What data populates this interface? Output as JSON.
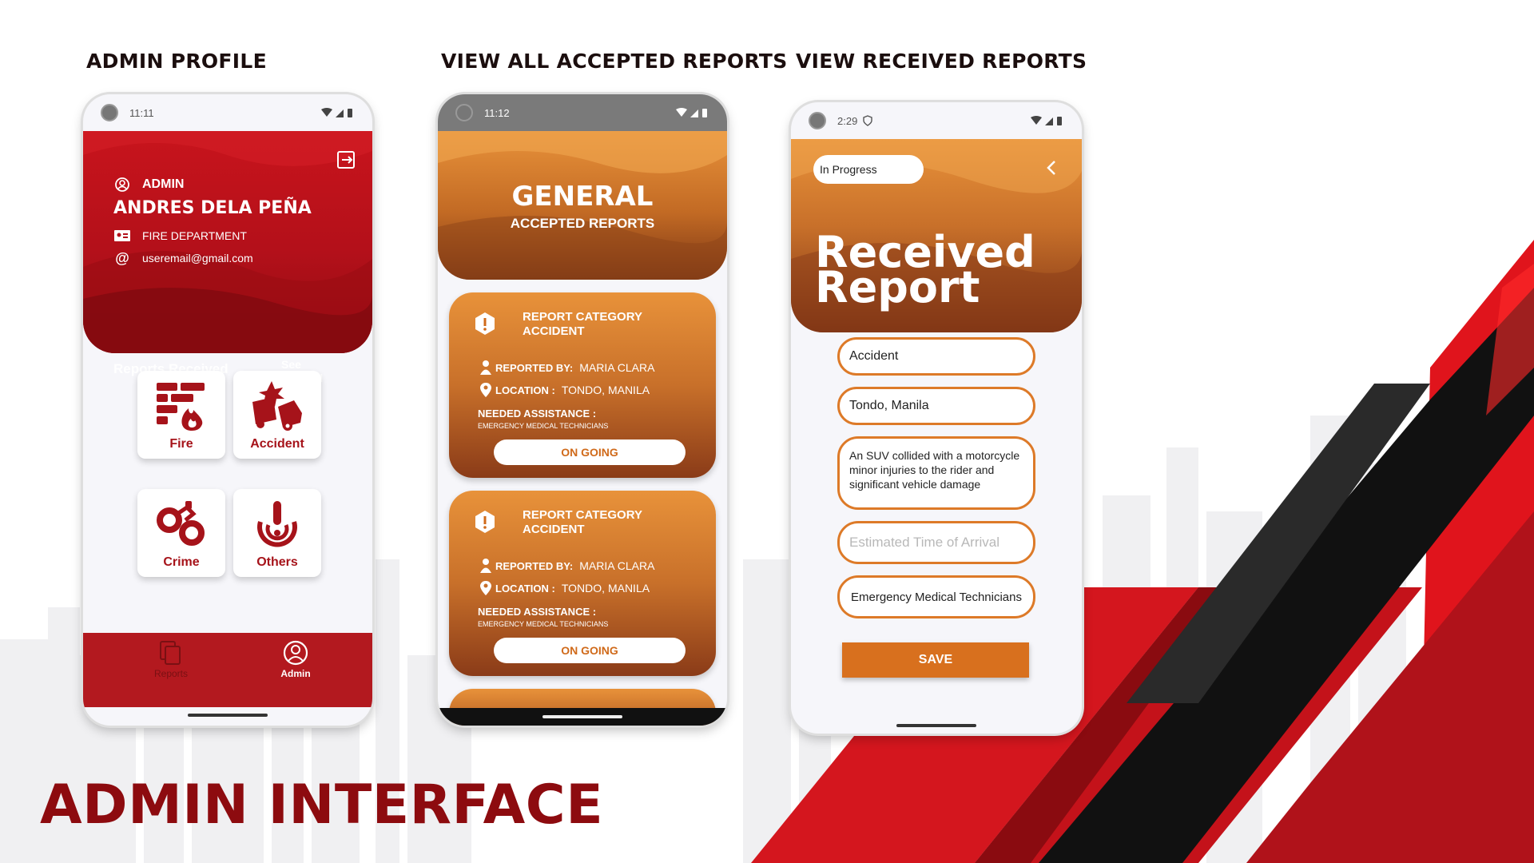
{
  "colors": {
    "brand_red": "#b3191f",
    "dark_red": "#8d0b0f",
    "orange": "#d8701e",
    "orange_light": "#e8923a"
  },
  "titles": {
    "admin_profile": "ADMIN PROFILE",
    "accepted_reports": "VIEW ALL ACCEPTED REPORTS",
    "received_reports": "VIEW RECEIVED REPORTS",
    "main": "ADMIN INTERFACE"
  },
  "phone1": {
    "time": "11:11",
    "role": "ADMIN",
    "name": "ANDRES DELA PEÑA",
    "department": "FIRE DEPARTMENT",
    "email": "useremail@gmail.com",
    "reports_received": "Reports Received",
    "see_general": "See General",
    "categories": [
      {
        "label": "Fire",
        "icon": "fire-wall-icon"
      },
      {
        "label": "Accident",
        "icon": "car-crash-icon"
      },
      {
        "label": "Crime",
        "icon": "handcuffs-icon"
      },
      {
        "label": "Others",
        "icon": "alert-signal-icon"
      }
    ],
    "nav": [
      {
        "label": "Reports",
        "icon": "reports-icon",
        "active": false
      },
      {
        "label": "Admin",
        "icon": "admin-user-icon",
        "active": true
      }
    ]
  },
  "phone2": {
    "time": "11:12",
    "header_title": "GENERAL",
    "header_subtitle": "ACCEPTED REPORTS",
    "cards": [
      {
        "category_label": "REPORT CATEGORY",
        "category": "ACCIDENT",
        "reported_by_label": "REPORTED BY:",
        "reported_by": "MARIA CLARA",
        "location_label": "LOCATION :",
        "location": "TONDO, MANILA",
        "needed_label": "NEEDED ASSISTANCE :",
        "needed": "EMERGENCY MEDICAL TECHNICIANS",
        "status": "ON GOING"
      },
      {
        "category_label": "REPORT CATEGORY",
        "category": "ACCIDENT",
        "reported_by_label": "REPORTED BY:",
        "reported_by": "MARIA CLARA",
        "location_label": "LOCATION :",
        "location": "TONDO, MANILA",
        "needed_label": "NEEDED ASSISTANCE :",
        "needed": "EMERGENCY MEDICAL TECHNICIANS",
        "status": "ON GOING"
      }
    ]
  },
  "phone3": {
    "time": "2:29",
    "status_value": "In Progress",
    "title_line1": "Received",
    "title_line2": "Report",
    "category": "Accident",
    "location": "Tondo, Manila",
    "description": "An SUV collided with a motorcycle minor injuries to the rider and significant vehicle damage",
    "eta_placeholder": "Estimated Time of Arrival",
    "assistance": "Emergency Medical Technicians",
    "save_label": "SAVE"
  }
}
